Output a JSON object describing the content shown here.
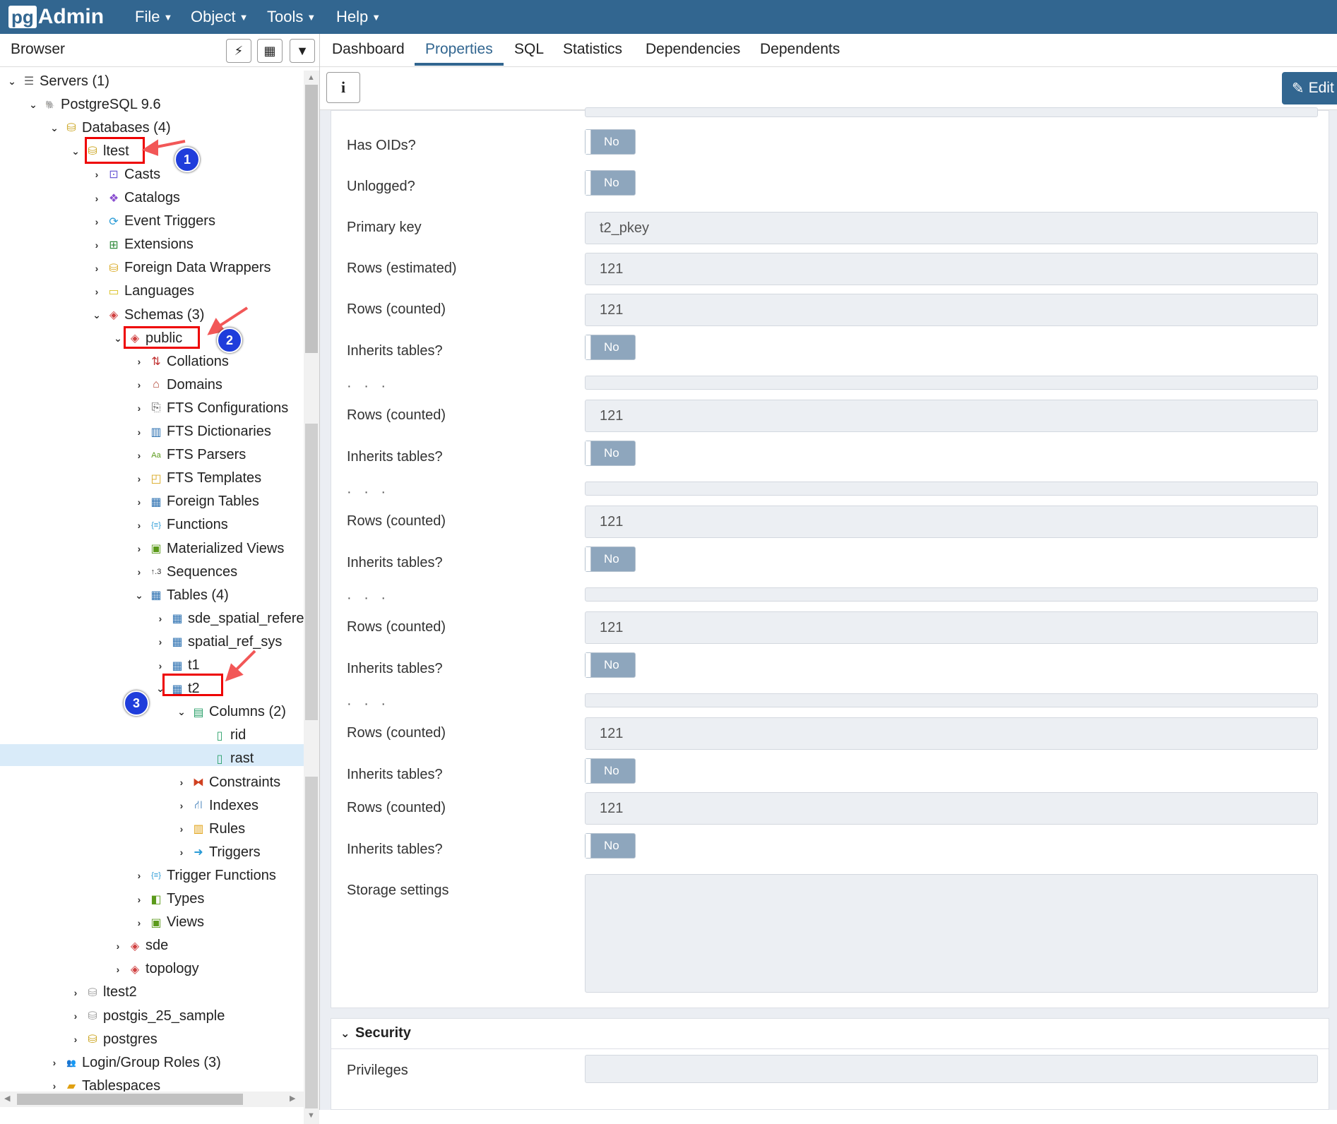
{
  "app": {
    "logo_pg": "pg",
    "logo_admin": "Admin"
  },
  "menu": [
    {
      "label": "File"
    },
    {
      "label": "Object"
    },
    {
      "label": "Tools"
    },
    {
      "label": "Help"
    }
  ],
  "browser": {
    "title": "Browser"
  },
  "tree": [
    {
      "label": "Servers (1)",
      "icon": "server-icon"
    },
    {
      "label": "PostgreSQL 9.6",
      "icon": "elephant-icon"
    },
    {
      "label": "Databases (4)",
      "icon": "databases-icon"
    },
    {
      "label": "ltest",
      "icon": "database-icon"
    },
    {
      "label": "Casts",
      "icon": "cast-icon"
    },
    {
      "label": "Catalogs",
      "icon": "catalog-icon"
    },
    {
      "label": "Event Triggers",
      "icon": "event-trigger-icon"
    },
    {
      "label": "Extensions",
      "icon": "extension-icon"
    },
    {
      "label": "Foreign Data Wrappers",
      "icon": "fdw-icon"
    },
    {
      "label": "Languages",
      "icon": "language-icon"
    },
    {
      "label": "Schemas (3)",
      "icon": "schemas-icon"
    },
    {
      "label": "public",
      "icon": "schema-icon"
    },
    {
      "label": "Collations",
      "icon": "collation-icon"
    },
    {
      "label": "Domains",
      "icon": "domain-icon"
    },
    {
      "label": "FTS Configurations",
      "icon": "fts-config-icon"
    },
    {
      "label": "FTS Dictionaries",
      "icon": "fts-dict-icon"
    },
    {
      "label": "FTS Parsers",
      "icon": "fts-parser-icon"
    },
    {
      "label": "FTS Templates",
      "icon": "fts-template-icon"
    },
    {
      "label": "Foreign Tables",
      "icon": "foreign-table-icon"
    },
    {
      "label": "Functions",
      "icon": "function-icon"
    },
    {
      "label": "Materialized Views",
      "icon": "mview-icon"
    },
    {
      "label": "Sequences",
      "icon": "sequence-icon"
    },
    {
      "label": "Tables (4)",
      "icon": "tables-icon"
    },
    {
      "label": "sde_spatial_refere",
      "icon": "table-icon"
    },
    {
      "label": "spatial_ref_sys",
      "icon": "table-icon"
    },
    {
      "label": "t1",
      "icon": "table-icon"
    },
    {
      "label": "t2",
      "icon": "table-icon"
    },
    {
      "label": "Columns (2)",
      "icon": "columns-icon"
    },
    {
      "label": "rid",
      "icon": "column-icon"
    },
    {
      "label": "rast",
      "icon": "column-icon"
    },
    {
      "label": "Constraints",
      "icon": "constraint-icon"
    },
    {
      "label": "Indexes",
      "icon": "index-icon"
    },
    {
      "label": "Rules",
      "icon": "rule-icon"
    },
    {
      "label": "Triggers",
      "icon": "trigger-icon"
    },
    {
      "label": "Trigger Functions",
      "icon": "trigger-function-icon"
    },
    {
      "label": "Types",
      "icon": "type-icon"
    },
    {
      "label": "Views",
      "icon": "view-icon"
    },
    {
      "label": "sde",
      "icon": "schema-icon"
    },
    {
      "label": "topology",
      "icon": "schema-icon"
    },
    {
      "label": "ltest2",
      "icon": "database-disconnected-icon"
    },
    {
      "label": "postgis_25_sample",
      "icon": "database-disconnected-icon"
    },
    {
      "label": "postgres",
      "icon": "database-icon"
    },
    {
      "label": "Login/Group Roles (3)",
      "icon": "roles-icon"
    },
    {
      "label": "Tablespaces",
      "icon": "tablespace-icon"
    }
  ],
  "annotations": [
    "1",
    "2",
    "3"
  ],
  "tabs": [
    {
      "label": "Dashboard"
    },
    {
      "label": "Properties"
    },
    {
      "label": "SQL"
    },
    {
      "label": "Statistics"
    },
    {
      "label": "Dependencies"
    },
    {
      "label": "Dependents"
    }
  ],
  "active_tab": "Properties",
  "toolbar": {
    "info_label": "i",
    "edit_label": "Edit"
  },
  "properties": {
    "has_oids": {
      "label": "Has OIDs?",
      "value": "No"
    },
    "unlogged": {
      "label": "Unlogged?",
      "value": "No"
    },
    "primary_key": {
      "label": "Primary key",
      "value": "t2_pkey"
    },
    "rows_estimated": {
      "label": "Rows (estimated)",
      "value": "121"
    },
    "rows_counted": {
      "label": "Rows (counted)",
      "value": "121"
    },
    "inherits_tables": {
      "label": "Inherits tables?",
      "value": "No"
    },
    "storage_settings": {
      "label": "Storage settings"
    }
  },
  "security": {
    "title": "Security",
    "privileges_label": "Privileges"
  },
  "colors": {
    "nav": "#326690",
    "toggle_off": "#8ea6bd",
    "selection": "#d9ebf9",
    "annotation_red": "#ee0000",
    "badge_blue": "#1f3ddb"
  }
}
